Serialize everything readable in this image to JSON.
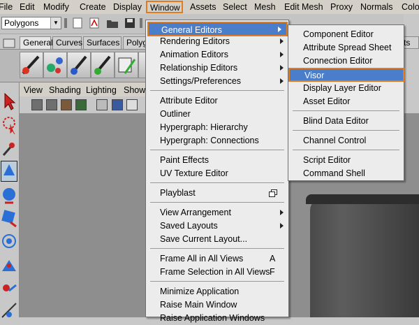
{
  "menubar": {
    "items": [
      "File",
      "Edit",
      "Modify",
      "Create",
      "Display",
      "Window",
      "Assets",
      "Select",
      "Mesh",
      "Edit Mesh",
      "Proxy",
      "Normals",
      "Colo"
    ]
  },
  "toolbar": {
    "mode": "Polygons"
  },
  "shelf": {
    "tabs": [
      "General",
      "Curves",
      "Surfaces",
      "Polyg"
    ],
    "right_tab": "ts"
  },
  "viewport_menu": [
    "View",
    "Shading",
    "Lighting",
    "Show"
  ],
  "window_menu": {
    "items": [
      {
        "label": "General Editors",
        "submenu": true
      },
      {
        "label": "Rendering Editors",
        "submenu": true
      },
      {
        "label": "Animation Editors",
        "submenu": true
      },
      {
        "label": "Relationship Editors",
        "submenu": true
      },
      {
        "label": "Settings/Preferences",
        "submenu": true
      },
      {
        "label": "Attribute Editor"
      },
      {
        "label": "Outliner"
      },
      {
        "label": "Hypergraph: Hierarchy"
      },
      {
        "label": "Hypergraph: Connections"
      },
      {
        "label": "Paint Effects"
      },
      {
        "label": "UV Texture Editor"
      },
      {
        "label": "Playblast"
      },
      {
        "label": "View Arrangement",
        "submenu": true
      },
      {
        "label": "Saved Layouts",
        "submenu": true
      },
      {
        "label": "Save Current Layout..."
      },
      {
        "label": "Frame All in All Views",
        "shortcut": "A"
      },
      {
        "label": "Frame Selection in All Views",
        "shortcut": "F"
      },
      {
        "label": "Minimize Application"
      },
      {
        "label": "Raise Main Window"
      },
      {
        "label": "Raise Application Windows"
      }
    ]
  },
  "general_editors_submenu": {
    "items": [
      "Component Editor",
      "Attribute Spread Sheet",
      "Connection Editor",
      "Visor",
      "Display Layer Editor",
      "Asset Editor",
      "Blind Data Editor",
      "Channel Control",
      "Script Editor",
      "Command Shell"
    ]
  },
  "colors": {
    "highlight": "#4a7ecb",
    "callout": "#e07b1f"
  }
}
